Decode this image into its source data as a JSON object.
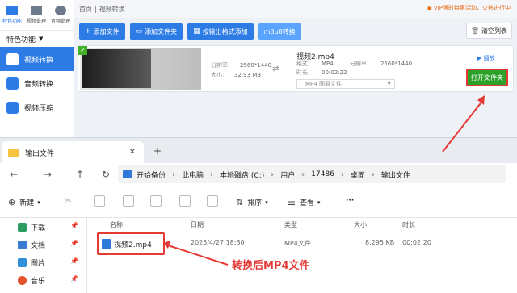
{
  "app": {
    "top_icons": [
      {
        "label": "特色功能",
        "icon": "star-icon",
        "color": "#1f6fe5"
      },
      {
        "label": "视频处理",
        "icon": "film-icon",
        "color": "#555"
      },
      {
        "label": "音频处理",
        "icon": "music-icon",
        "color": "#555"
      }
    ],
    "feature_header": "特色功能",
    "nav": [
      {
        "label": "视频转换",
        "icon": "video-convert-icon",
        "active": true
      },
      {
        "label": "音频转换",
        "icon": "audio-convert-icon",
        "active": false
      },
      {
        "label": "视频压缩",
        "icon": "video-compress-icon",
        "active": false
      }
    ],
    "breadcrumb": [
      "首页",
      "视频转换"
    ],
    "vip_banner": "VIP限时特惠活动，火热进行中",
    "toolbar": {
      "add_file": "添加文件",
      "add_folder": "添加文件夹",
      "batch_add": "按输出格式添加",
      "m3u8": "m3u8转换",
      "clear_list": "清空列表"
    },
    "file": {
      "source": {
        "res_label": "分辨率：",
        "res": "2560*1440",
        "size_label": "大小：",
        "size": "32.93 MB"
      },
      "name": "视频2.mp4",
      "output": {
        "fmt_label": "格式：",
        "fmt": "MP4",
        "res_label": "分辨率：",
        "res": "2560*1440",
        "dur_label": "时长：",
        "dur": "00:02:22"
      },
      "format_select": "MP4  同原文件",
      "play": "播放",
      "open_folder": "打开文件夹"
    }
  },
  "explorer": {
    "tab_title": "输出文件",
    "address": [
      "开始备份",
      "此电脑",
      "本地磁盘 (C:)",
      "用户",
      "17486",
      "桌面",
      "输出文件"
    ],
    "commands": {
      "new": "新建",
      "sort": "排序",
      "view": "查看",
      "more": "···"
    },
    "sidebar": [
      {
        "label": "下载",
        "icon": "download-icon"
      },
      {
        "label": "文档",
        "icon": "document-icon"
      },
      {
        "label": "图片",
        "icon": "picture-icon"
      },
      {
        "label": "音乐",
        "icon": "music-icon"
      }
    ],
    "columns": {
      "name": "名称",
      "date": "日期",
      "type": "类型",
      "size": "大小",
      "duration": "时长"
    },
    "rows": [
      {
        "name": "视频2.mp4",
        "date": "2025/4/27 18:30",
        "type": "MP4文件",
        "size": "8,295 KB",
        "duration": "00:02:20"
      }
    ],
    "annotation": "转换后MP4文件"
  }
}
